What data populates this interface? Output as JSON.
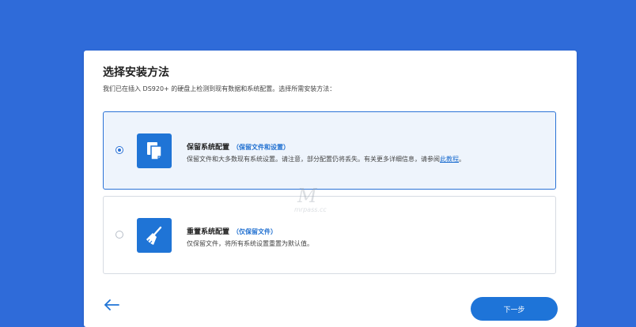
{
  "dialog": {
    "title": "选择安装方法",
    "subtitle": "我们已在插入 DS920+ 的硬盘上检测到现有数据和系统配置。选择所需安装方法："
  },
  "options": [
    {
      "title": "保留系统配置",
      "tag": "（保留文件和设置）",
      "description": "保留文件和大多数现有系统设置。请注意，部分配置仍将丢失。有关更多详细信息，请参阅",
      "link": "此教程",
      "description_end": "。",
      "selected": true,
      "icon": "copy-files-icon"
    },
    {
      "title": "重置系统配置",
      "tag": "（仅保留文件）",
      "description": "仅保留文件，将所有系统设置重置为默认值。",
      "selected": false,
      "icon": "broom-icon"
    }
  ],
  "footer": {
    "back_icon": "arrow-left-icon",
    "next_label": "下一步"
  },
  "watermark": {
    "text": "M mrpass.cc"
  },
  "colors": {
    "background": "#2f6bd9",
    "accent": "#1e74d8",
    "selected_bg": "#eef4fc"
  }
}
